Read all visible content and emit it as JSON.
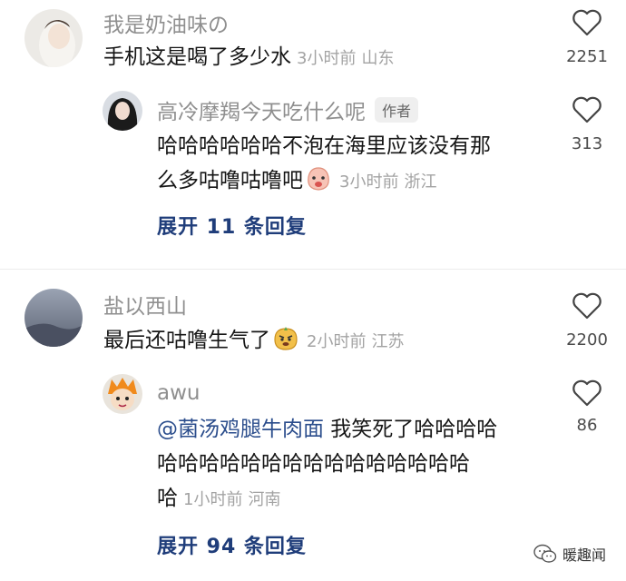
{
  "comments": [
    {
      "username": "我是奶油味の",
      "text": "手机这是喝了多少水",
      "time": "3小时前",
      "location": "山东",
      "likes": "2251",
      "reply": {
        "username": "高冷摩羯今天吃什么呢",
        "badge": "作者",
        "text_line1": "哈哈哈哈哈哈不泡在海里应该没有那",
        "text_line2": "么多咕噜咕噜吧",
        "emoji": "peach-face-emoji",
        "time": "3小时前",
        "location": "浙江",
        "likes": "313"
      },
      "expand_label": "展开 11 条回复"
    },
    {
      "username": "盐以西山",
      "text": "最后还咕噜生气了",
      "emoji": "angry-face-emoji",
      "time": "2小时前",
      "location": "江苏",
      "likes": "2200",
      "reply": {
        "username": "awu",
        "mention": "@菌汤鸡腿牛肉面",
        "text_line1": " 我笑死了哈哈哈哈",
        "text_line2": "哈哈哈哈哈哈哈哈哈哈哈哈哈哈哈",
        "text_line3": "哈",
        "time": "1小时前",
        "location": "河南",
        "likes": "86"
      },
      "expand_label": "展开 94 条回复"
    }
  ],
  "watermark": {
    "label": "暖趣闻",
    "icon": "wechat-icon"
  },
  "colors": {
    "link": "#1f3d7a",
    "mention": "#2b4d8c",
    "meta": "#a3a3a3",
    "username": "#8f8f8f"
  }
}
